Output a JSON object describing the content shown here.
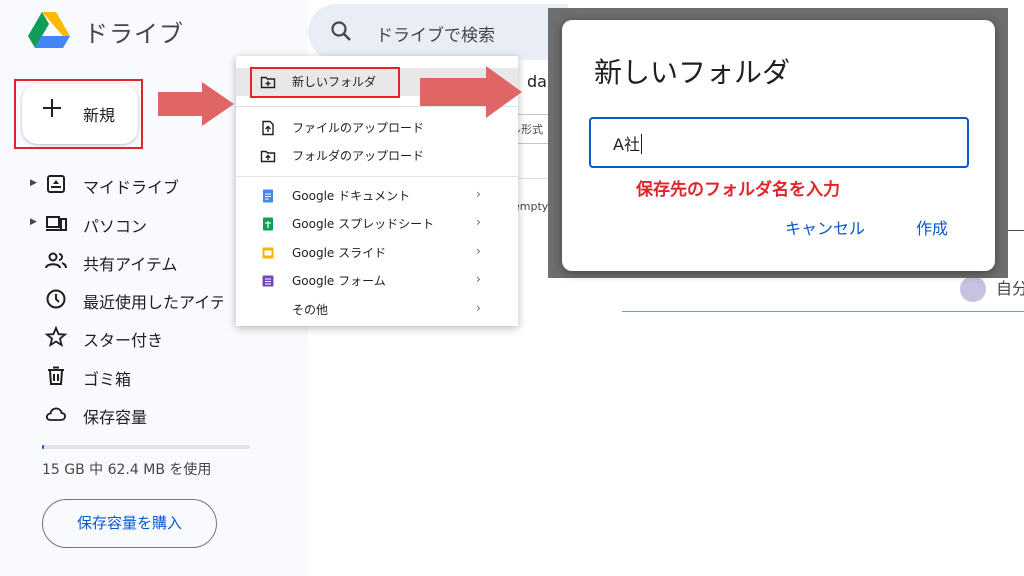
{
  "header": {
    "app_title": "ドライブ",
    "search_placeholder": "ドライブで検索",
    "logo_icon": "google-drive-logo"
  },
  "new_button": {
    "label": "新規"
  },
  "nav": {
    "items": [
      {
        "label": "マイドライブ",
        "icon": "my-drive-icon",
        "expandable": true
      },
      {
        "label": "パソコン",
        "icon": "computers-icon",
        "expandable": true
      },
      {
        "label": "共有アイテム",
        "icon": "shared-icon",
        "expandable": false
      },
      {
        "label": "最近使用したアイテム",
        "icon": "clock-icon",
        "expandable": false
      },
      {
        "label": "スター付き",
        "icon": "star-icon",
        "expandable": false
      },
      {
        "label": "ゴミ箱",
        "icon": "trash-icon",
        "expandable": false
      },
      {
        "label": "保存容量",
        "icon": "cloud-icon",
        "expandable": false
      }
    ]
  },
  "storage": {
    "usage_text": "15 GB 中 62.4 MB を使用",
    "used_fraction": 0.004,
    "buy_label": "保存容量を購入"
  },
  "menu": {
    "items": [
      {
        "label": "新しいフォルダ",
        "icon": "new-folder-icon",
        "submenu": false
      },
      {
        "label": "ファイルのアップロード",
        "icon": "file-upload-icon",
        "submenu": false
      },
      {
        "label": "フォルダのアップロード",
        "icon": "folder-upload-icon",
        "submenu": false
      },
      {
        "label": "Google ドキュメント",
        "icon": "docs-icon",
        "submenu": true
      },
      {
        "label": "Google スプレッドシート",
        "icon": "sheets-icon",
        "submenu": true
      },
      {
        "label": "Google スライド",
        "icon": "slides-icon",
        "submenu": true
      },
      {
        "label": "Google フォーム",
        "icon": "forms-icon",
        "submenu": true
      },
      {
        "label": "その他",
        "icon": "",
        "submenu": true
      }
    ]
  },
  "background": {
    "partial_heading": "da",
    "partial_chip": "ル形式",
    "partial_empty": "empty"
  },
  "dialog": {
    "title": "新しいフォルダ",
    "input_value": "A社",
    "cancel_label": "キャンセル",
    "create_label": "作成"
  },
  "annotation": {
    "text": "保存先のフォルダ名を入力"
  },
  "colors": {
    "highlight_red": "#e0242a",
    "arrow_red": "#e06666",
    "accent_blue": "#0b57d0",
    "docs_blue": "#4285f4",
    "sheets_green": "#0f9d58",
    "slides_yellow": "#f4b400",
    "forms_purple": "#7248b9"
  },
  "owner": {
    "partial_label": "自分"
  }
}
